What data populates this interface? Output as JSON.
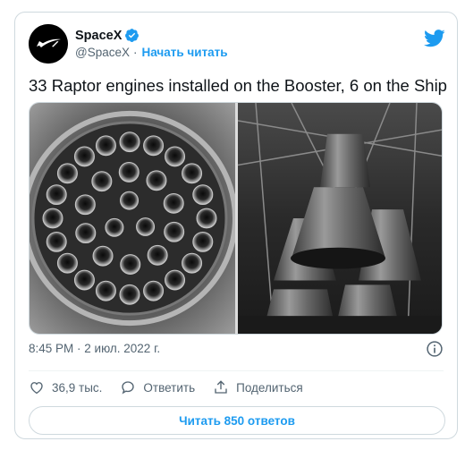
{
  "author": {
    "display_name": "SpaceX",
    "handle": "@SpaceX",
    "separator": "·",
    "follow_label": "Начать читать"
  },
  "tweet": {
    "text": "33 Raptor engines installed on the Booster, 6 on the Ship",
    "timestamp": "8:45 PM · 2 июл. 2022 г."
  },
  "actions": {
    "likes": "36,9 тыс.",
    "reply_label": "Ответить",
    "share_label": "Поделиться"
  },
  "replies_button_label": "Читать 850 ответов",
  "colors": {
    "accent": "#1d9bf0",
    "secondary_text": "#536471",
    "border": "#cfd9de"
  },
  "icons": [
    "spacex-logo-icon",
    "verified-badge-icon",
    "twitter-bird-icon",
    "info-icon",
    "heart-icon",
    "reply-icon",
    "share-icon"
  ]
}
